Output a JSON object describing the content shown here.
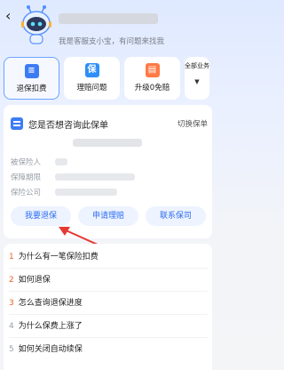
{
  "header": {
    "back_icon": "chevron-left-icon",
    "greeting": "我是客服支小宝，有问题来找我"
  },
  "quick_actions": [
    {
      "label": "退保扣费",
      "icon": "document-icon",
      "color": "#3d7bf5",
      "active": true
    },
    {
      "label": "理赔问题",
      "icon": "bao-icon",
      "glyph": "保",
      "color": "#2f8ef7",
      "active": false
    },
    {
      "label": "升级0免赔",
      "icon": "book-icon",
      "color": "#ff7a45",
      "active": false
    },
    {
      "label": "全部业务",
      "icon": "chevron-down-icon",
      "active": false
    }
  ],
  "policy_card": {
    "title": "您是否想咨询此保单",
    "switch_label": "切换保单",
    "fields": [
      {
        "label": "被保险人"
      },
      {
        "label": "保障期限"
      },
      {
        "label": "保险公司"
      }
    ],
    "buttons": [
      "我要退保",
      "申请理赔",
      "联系保司"
    ]
  },
  "faq": [
    {
      "num": "1",
      "text": "为什么有一笔保险扣费"
    },
    {
      "num": "2",
      "text": "如何退保"
    },
    {
      "num": "3",
      "text": "怎么查询退保进度"
    },
    {
      "num": "4",
      "text": "为什么保费上涨了"
    },
    {
      "num": "5",
      "text": "如何关闭自动续保"
    }
  ],
  "colors": {
    "accent": "#2f6ef2",
    "faq_number": "#e8622c",
    "arrow": "#e53935"
  }
}
